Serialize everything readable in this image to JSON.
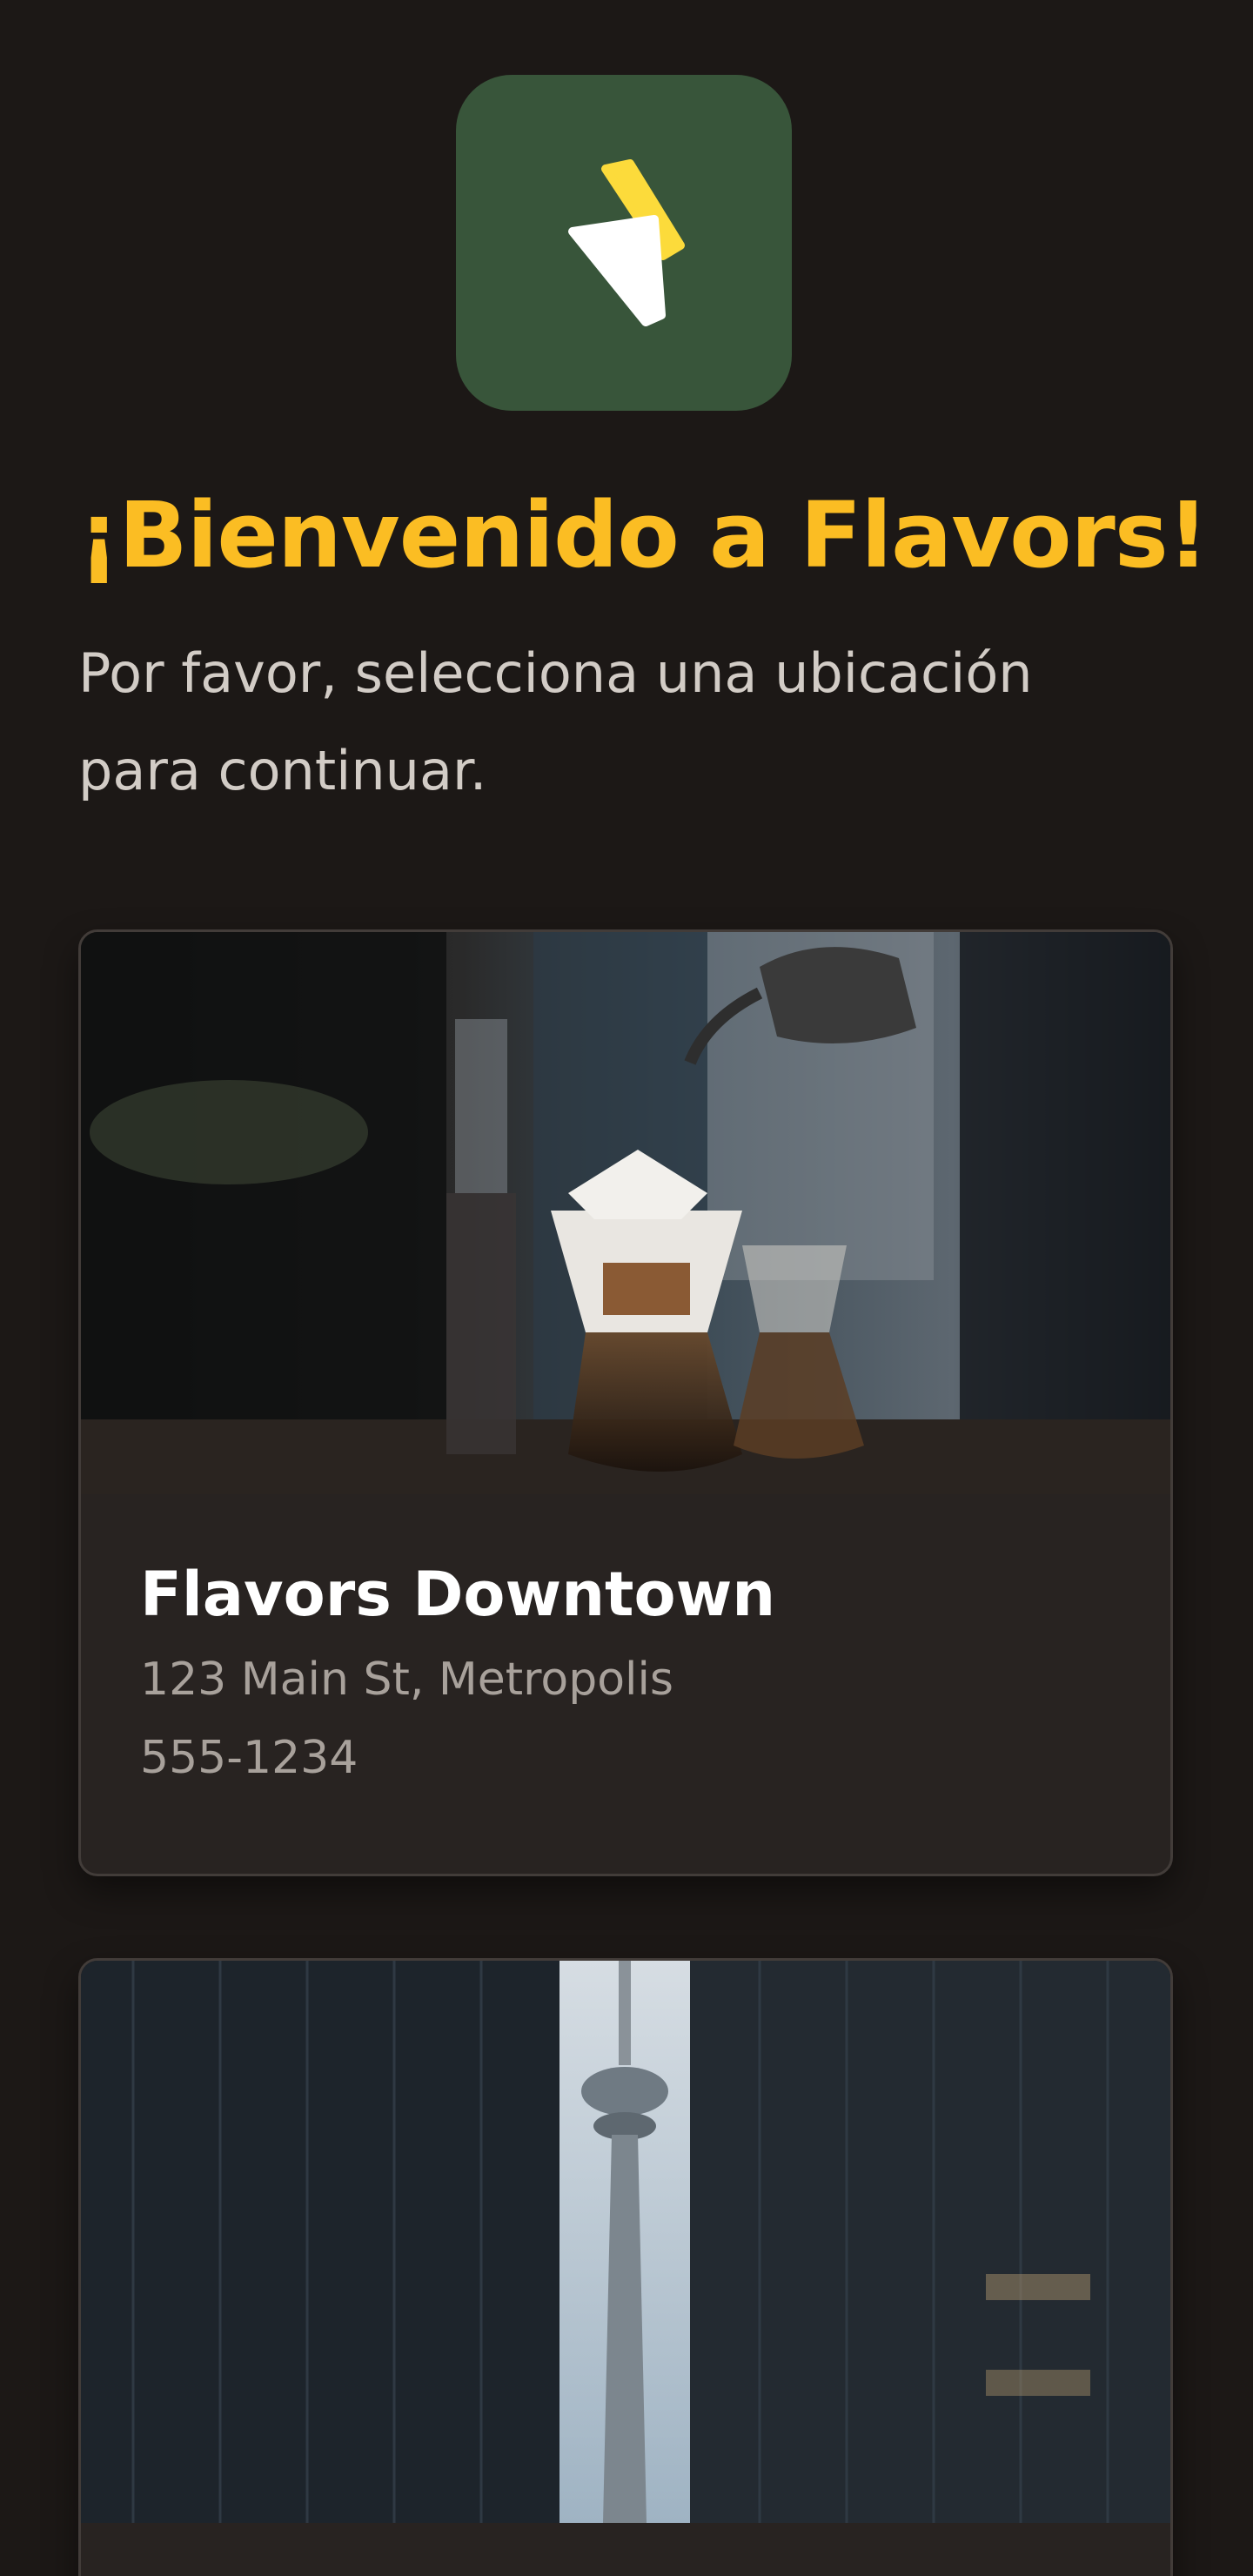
{
  "app": {
    "logo_icon": "lightning-bolt-icon",
    "logo_colors": {
      "background": "#38553a",
      "bolt_primary": "#fcdb3b",
      "bolt_secondary": "#ffffff"
    }
  },
  "header": {
    "title": "¡Bienvenido a Flavors!",
    "subtitle": "Por favor, selecciona una ubicación para continuar."
  },
  "locations": [
    {
      "name": "Flavors Downtown",
      "address": "123 Main St, Metropolis",
      "phone": "555-1234",
      "image": "coffee-brewing-photo"
    },
    {
      "image": "city-tower-photo"
    }
  ],
  "colors": {
    "background": "#1c1816",
    "accent": "#fbbd23",
    "card": "#282321",
    "muted_text": "#a8a19b"
  }
}
